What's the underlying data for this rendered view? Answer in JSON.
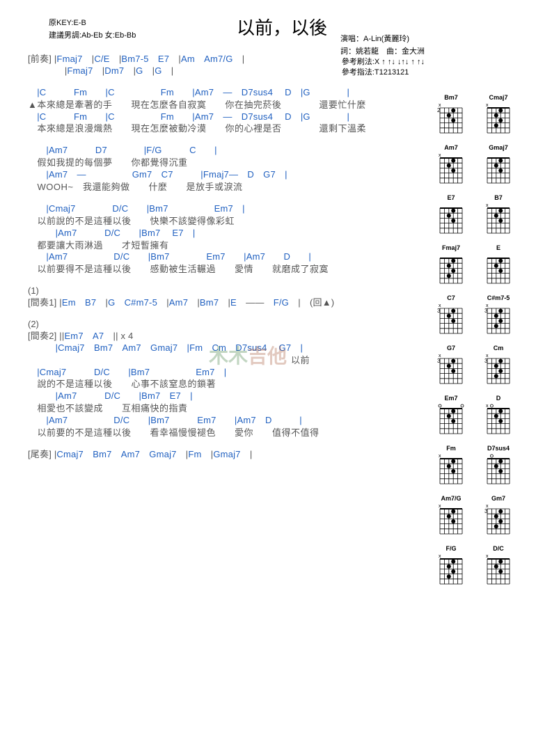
{
  "title": "以前，以後",
  "meta_left": {
    "key": "原KEY:E-B",
    "suggest": "建議男調:Ab-Eb 女:Eb-Bb"
  },
  "meta_right": {
    "perf": "演唱：A-Lin(黃麗玲)",
    "credit": "詞：姚若龍　曲：金大洲"
  },
  "meta_right2": {
    "strum": "參考刷法:X ↑ ↑↓ ↓↑↓ ↑ ↑↓",
    "pick": "參考指法:T1213121"
  },
  "lines": [
    {
      "type": "mix",
      "t": "[前奏] |Fmaj7　|C/E　|Bm7-5　E7　|Am　Am7/G　|"
    },
    {
      "type": "mix",
      "t": "　　　　|Fmaj7　|Dm7　|G　|G　|"
    },
    {
      "type": "gap"
    },
    {
      "type": "ch",
      "t": "　|C　　　Fm　　|C　　　　　Fm　　|Am7　—　D7sus4　 D　|G　　　　|"
    },
    {
      "type": "ly",
      "t": "▲本來總是牽著的手　　現在怎麼各自寂寞　　你在抽完菸後　　　　還要忙什麼"
    },
    {
      "type": "ch",
      "t": "　|C　　　Fm　　|C　　　　　Fm　　|Am7　—　D7sus4　 D　|G　　　　|"
    },
    {
      "type": "ly",
      "t": "　本來總是浪漫熾熱　　現在怎麼被動冷漠　　你的心裡是否　　　　還剩下溫柔"
    },
    {
      "type": "gap"
    },
    {
      "type": "ch",
      "t": "　　|Am7　　　D7　　　　|F/G　　　C　　|"
    },
    {
      "type": "ly",
      "t": "　假如我提的每個夢　　你都覺得沉重"
    },
    {
      "type": "ch",
      "t": "　　|Am7　—　　　　　Gm7　C7　　　|Fmaj7—　D　G7　|"
    },
    {
      "type": "ly",
      "t": "　WOOH~　我還能夠做　　什麼　　是放手或淚流"
    },
    {
      "type": "gap"
    },
    {
      "type": "ch",
      "t": "　　|Cmaj7　　　　D/C　　|Bm7　　　　　Em7　|"
    },
    {
      "type": "ly",
      "t": "　以前說的不是這種以後　　快樂不該變得像彩虹"
    },
    {
      "type": "ch",
      "t": "　　　|Am7　　　D/C　　|Bm7　 E7　|"
    },
    {
      "type": "ly",
      "t": "　都要讓大雨淋過　　才短暫擁有"
    },
    {
      "type": "ch",
      "t": "　　|Am7　　　　　D/C　　|Bm7　　　　Em7　　|Am7　　D　　|"
    },
    {
      "type": "ly",
      "t": "　以前要得不是這種以後　　感動被生活輾過　　愛情　　就磨成了寂寞"
    },
    {
      "type": "gap"
    },
    {
      "type": "lbl",
      "t": "(1)"
    },
    {
      "type": "mix",
      "t": "[間奏1] |Em　B7　|G　C#m7-5　|Am7　|Bm7　|E　——　F/G　|　(回▲)"
    },
    {
      "type": "gap"
    },
    {
      "type": "lbl",
      "t": "(2)"
    },
    {
      "type": "mix",
      "t": "[間奏2] ||Em7　A7　|| x 4"
    },
    {
      "type": "ch",
      "t": "　　　|Cmaj7　Bm7　Am7　Gmaj7　|Fm　Cm　D7sus4　 G7　|"
    },
    {
      "type": "ly",
      "t": "　　　　　　　　　　　　　　　　　　　　　　　　　　　　以前"
    },
    {
      "type": "ch",
      "t": "　|Cmaj7　　　D/C　　|Bm7　　　　　Em7　|"
    },
    {
      "type": "ly",
      "t": "　說的不是這種以後　　心事不該窒息的鎖著"
    },
    {
      "type": "ch",
      "t": "　　　|Am7　　　D/C　　|Bm7　E7　|"
    },
    {
      "type": "ly",
      "t": "　相愛也不該變成　　互相痛快的指責"
    },
    {
      "type": "ch",
      "t": "　　|Am7　　　　　D/C　　|Bm7　　　Em7　　|Am7　D　　　|"
    },
    {
      "type": "ly",
      "t": "　以前要的不是這種以後　　看幸福慢慢褪色　　愛你　　值得不值得"
    },
    {
      "type": "gap"
    },
    {
      "type": "mix",
      "t": "[尾奏] |Cmaj7　Bm7　Am7　Gmaj7　|Fm　|Gmaj7　|"
    }
  ],
  "diagrams": [
    [
      "Bm7",
      "Cmaj7"
    ],
    [
      "Am7",
      "Gmaj7"
    ],
    [
      "E7",
      "B7"
    ],
    [
      "Fmaj7",
      "E"
    ],
    [
      "C7",
      "C#m7-5"
    ],
    [
      "G7",
      "Cm"
    ],
    [
      "Em7",
      "D"
    ],
    [
      "Fm",
      "D7sus4"
    ],
    [
      "Am7/G",
      "Gm7"
    ],
    [
      "F/G",
      "D/C"
    ]
  ],
  "diag_hints": {
    "Bm7": {
      "fret": "2",
      "mute": [
        0
      ]
    },
    "Cmaj7": {
      "mute": [
        0
      ]
    },
    "Am7": {
      "mute": [
        0
      ]
    },
    "Gmaj7": {
      "mute": []
    },
    "E7": {},
    "B7": {
      "mute": [
        0
      ]
    },
    "Fmaj7": {},
    "E": {},
    "C7": {
      "fret": "3",
      "mute": [
        0
      ]
    },
    "C#m7-5": {
      "fret": "3",
      "mute": [
        0
      ]
    },
    "G7": {
      "fret": "3",
      "mute": [
        0
      ]
    },
    "Cm": {
      "fret": "3",
      "mute": [
        0
      ]
    },
    "Em7": {
      "open": [
        0,
        5
      ]
    },
    "D": {
      "mute": [
        0
      ],
      "open": [
        1
      ]
    },
    "Fm": {
      "mute": [
        0
      ]
    },
    "D7sus4": {
      "open": [
        1
      ]
    },
    "Am7/G": {
      "mute": [
        0
      ]
    },
    "Gm7": {
      "fret": "3",
      "mute": [
        0
      ]
    },
    "F/G": {
      "mute": [
        0
      ]
    },
    "D/C": {
      "mute": [
        0
      ]
    }
  },
  "watermark": {
    "a": "木木",
    "b": "吉他"
  }
}
